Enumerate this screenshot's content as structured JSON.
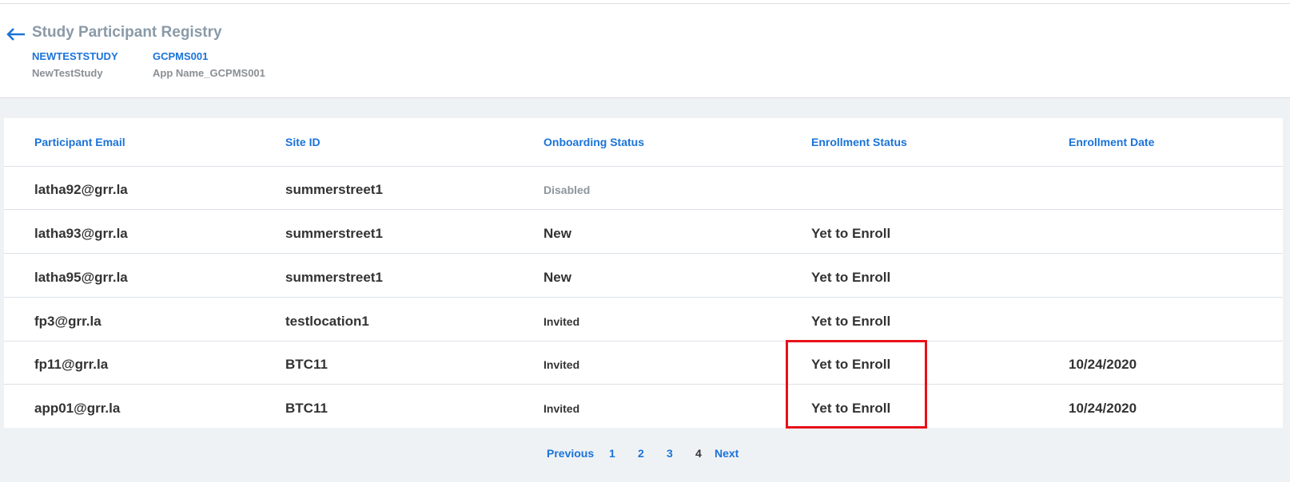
{
  "header": {
    "title": "Study Participant Registry",
    "study_code": "NEWTESTSTUDY",
    "study_name": "NewTestStudy",
    "app_code": "GCPMS001",
    "app_name": "App Name_GCPMS001"
  },
  "table": {
    "columns": [
      "Participant Email",
      "Site ID",
      "Onboarding Status",
      "Enrollment Status",
      "Enrollment Date"
    ],
    "rows": [
      {
        "email": "latha92@grr.la",
        "site": "summerstreet1",
        "onboarding": "Disabled",
        "enrollment": "",
        "date": ""
      },
      {
        "email": "latha93@grr.la",
        "site": "summerstreet1",
        "onboarding": "New",
        "enrollment": "Yet to Enroll",
        "date": ""
      },
      {
        "email": "latha95@grr.la",
        "site": "summerstreet1",
        "onboarding": "New",
        "enrollment": "Yet to Enroll",
        "date": ""
      },
      {
        "email": "fp3@grr.la",
        "site": "testlocation1",
        "onboarding": "Invited",
        "enrollment": "Yet to Enroll",
        "date": ""
      },
      {
        "email": "fp11@grr.la",
        "site": "BTC11",
        "onboarding": "Invited",
        "enrollment": "Yet to Enroll",
        "date": "10/24/2020"
      },
      {
        "email": "app01@grr.la",
        "site": "BTC11",
        "onboarding": "Invited",
        "enrollment": "Yet to Enroll",
        "date": "10/24/2020"
      }
    ]
  },
  "pagination": {
    "previous": "Previous",
    "pages": [
      "1",
      "2",
      "3",
      "4"
    ],
    "current": "4",
    "next": "Next"
  },
  "colors": {
    "accent": "#1a73d9",
    "title": "#8a9aa8",
    "highlight": "#e8101a",
    "background": "#eff2f5"
  }
}
